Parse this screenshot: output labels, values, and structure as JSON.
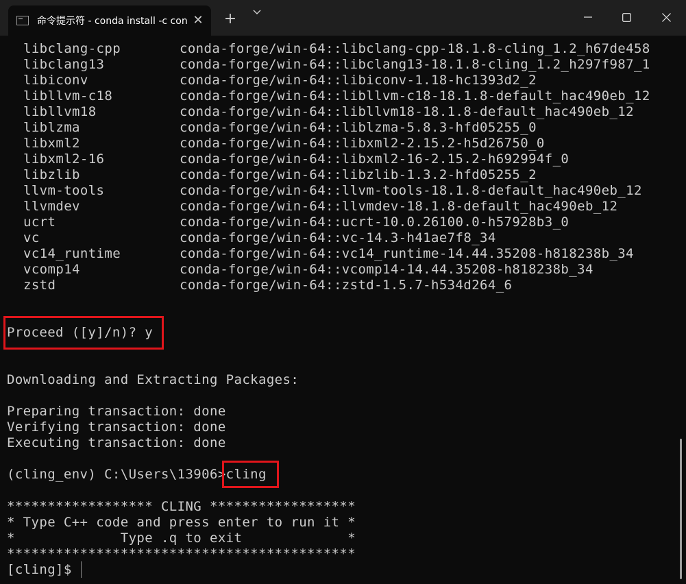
{
  "window": {
    "tab_title": "命令提示符 - conda  install -c conda-forge cling",
    "tab_icon": "terminal-icon",
    "close_tab_glyph": "✕",
    "new_tab_glyph": "+",
    "dropdown_icon": "chevron-down-icon"
  },
  "packages": [
    {
      "name": "libclang-cpp",
      "spec": "conda-forge/win-64::libclang-cpp-18.1.8-cling_1.2_h67de458"
    },
    {
      "name": "libclang13",
      "spec": "conda-forge/win-64::libclang13-18.1.8-cling_1.2_h297f987_1"
    },
    {
      "name": "libiconv",
      "spec": "conda-forge/win-64::libiconv-1.18-hc1393d2_2"
    },
    {
      "name": "libllvm-c18",
      "spec": "conda-forge/win-64::libllvm-c18-18.1.8-default_hac490eb_12"
    },
    {
      "name": "libllvm18",
      "spec": "conda-forge/win-64::libllvm18-18.1.8-default_hac490eb_12"
    },
    {
      "name": "liblzma",
      "spec": "conda-forge/win-64::liblzma-5.8.3-hfd05255_0"
    },
    {
      "name": "libxml2",
      "spec": "conda-forge/win-64::libxml2-2.15.2-h5d26750_0"
    },
    {
      "name": "libxml2-16",
      "spec": "conda-forge/win-64::libxml2-16-2.15.2-h692994f_0"
    },
    {
      "name": "libzlib",
      "spec": "conda-forge/win-64::libzlib-1.3.2-hfd05255_2"
    },
    {
      "name": "llvm-tools",
      "spec": "conda-forge/win-64::llvm-tools-18.1.8-default_hac490eb_12"
    },
    {
      "name": "llvmdev",
      "spec": "conda-forge/win-64::llvmdev-18.1.8-default_hac490eb_12"
    },
    {
      "name": "ucrt",
      "spec": "conda-forge/win-64::ucrt-10.0.26100.0-h57928b3_0"
    },
    {
      "name": "vc",
      "spec": "conda-forge/win-64::vc-14.3-h41ae7f8_34"
    },
    {
      "name": "vc14_runtime",
      "spec": "conda-forge/win-64::vc14_runtime-14.44.35208-h818238b_34"
    },
    {
      "name": "vcomp14",
      "spec": "conda-forge/win-64::vcomp14-14.44.35208-h818238b_34"
    },
    {
      "name": "zstd",
      "spec": "conda-forge/win-64::zstd-1.5.7-h534d264_6"
    }
  ],
  "output": {
    "proceed": "Proceed ([y]/n)? y",
    "downloading": "Downloading and Extracting Packages:",
    "preparing": "Preparing transaction: done",
    "verifying": "Verifying transaction: done",
    "executing": "Executing transaction: done",
    "prompt": "(cling_env) C:\\Users\\13906>cling",
    "banner_top": "****************** CLING ******************",
    "banner_line1": "* Type C++ code and press enter to run it *",
    "banner_line2": "*             Type .q to exit             *",
    "banner_bottom": "*******************************************",
    "cling_prompt": "[cling]$ "
  },
  "colors": {
    "background": "#0c0c0c",
    "text": "#cccccc",
    "highlight": "#e0151b"
  }
}
